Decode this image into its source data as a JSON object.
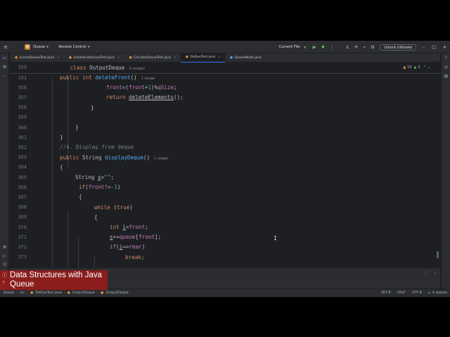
{
  "titlebar": {
    "project_badge": "Q",
    "project_name": "Queue",
    "vcs": "Version Control",
    "run_config": "Current File",
    "unlock_button": "Unlock Ultimate"
  },
  "tabs": [
    {
      "label": "LinearQueueTest.java"
    },
    {
      "label": "LinkedListQueueTest.java"
    },
    {
      "label": "CircularQueueTest.java"
    },
    {
      "label": "DeQueTest.java"
    },
    {
      "label": "QueueNode.java"
    }
  ],
  "inspections": {
    "warnings": "13",
    "ok": "3"
  },
  "code": {
    "sticky": {
      "ln": "259",
      "kw": "class",
      "name": "OutputDeque",
      "hint": "2 usages"
    },
    "lines": [
      {
        "ln": "331"
      },
      {
        "ln": "356"
      },
      {
        "ln": "357"
      },
      {
        "ln": "358"
      },
      {
        "ln": "359"
      },
      {
        "ln": "360"
      },
      {
        "ln": "361"
      },
      {
        "ln": "362"
      },
      {
        "ln": "363"
      },
      {
        "ln": "364"
      },
      {
        "ln": "365"
      },
      {
        "ln": "366"
      },
      {
        "ln": "367"
      },
      {
        "ln": "368"
      },
      {
        "ln": "369"
      },
      {
        "ln": "370"
      },
      {
        "ln": "371"
      },
      {
        "ln": "372"
      },
      {
        "ln": "373"
      }
    ],
    "tokens": {
      "l331_public": "public",
      "l331_int": "int",
      "l331_fn": "deleteFront",
      "l331_paren": "()",
      "l331_hint": "1 usage",
      "l356_a": "front",
      "l356_b": "=(",
      "l356_c": "front",
      "l356_d": "+",
      "l356_e": "1",
      "l356_f": ")%",
      "l356_g": "qSize",
      "l356_h": ";",
      "l357_return": "return",
      "l357_fn": "deleteElements",
      "l357_rest": "();",
      "l358_brace": "}",
      "l360_brace": "}",
      "l361_brace": "}",
      "l362_comment": "//4. Display from deque",
      "l363_public": "public",
      "l363_type": "String",
      "l363_fn": "displayDeque",
      "l363_paren": "()",
      "l363_hint": "1 usage",
      "l364_brace": "{",
      "l365_type": "String",
      "l365_var": "s",
      "l365_eq": "=",
      "l365_str": "\"\"",
      "l365_semi": ";",
      "l366_if": "if",
      "l366_a": "(",
      "l366_b": "front",
      "l366_c": "!=",
      "l366_d": "-1",
      "l366_e": ")",
      "l367_brace": "{",
      "l368_while": "while",
      "l368_a": " (",
      "l368_true": "true",
      "l368_b": ")",
      "l369_brace": "{",
      "l370_int": "int",
      "l370_var": "i",
      "l370_eq": "=",
      "l370_field": "front",
      "l370_semi": ";",
      "l371_var": "s",
      "l371_op": "+=",
      "l371_field": "queue",
      "l371_b1": "[",
      "l371_field2": "front",
      "l371_b2": "];",
      "l372_if": "if",
      "l372_a": "(",
      "l372_var": "i",
      "l372_op": "==",
      "l372_field": "rear",
      "l372_b": ")",
      "l373_break": "break",
      "l373_semi": ";"
    }
  },
  "statusbar": {
    "crumbs": [
      "Queue",
      "src",
      "DeQueTest.java",
      "OutputDeque",
      "OutputDeque"
    ],
    "position": "367:8",
    "line_sep": "CRLF",
    "encoding": "UTF-8",
    "indent": "4 spaces"
  },
  "caption": {
    "line1": "Data Structures with Java",
    "line2": "Queue"
  }
}
